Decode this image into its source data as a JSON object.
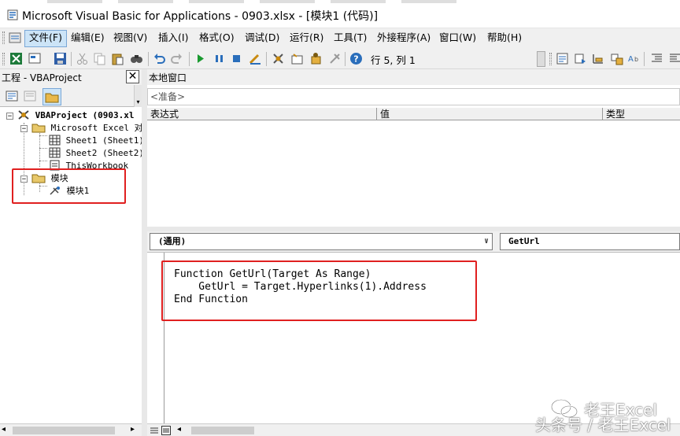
{
  "window": {
    "title": "Microsoft Visual Basic for Applications - 0903.xlsx - [模块1 (代码)]"
  },
  "menu": {
    "items": [
      {
        "label": "文件(F)",
        "active": true
      },
      {
        "label": "编辑(E)"
      },
      {
        "label": "视图(V)"
      },
      {
        "label": "插入(I)"
      },
      {
        "label": "格式(O)"
      },
      {
        "label": "调试(D)"
      },
      {
        "label": "运行(R)"
      },
      {
        "label": "工具(T)"
      },
      {
        "label": "外接程序(A)"
      },
      {
        "label": "窗口(W)"
      },
      {
        "label": "帮助(H)"
      }
    ]
  },
  "toolbar": {
    "cursor_position": "行 5, 列 1",
    "icons": [
      "excel-view-icon",
      "insert-userform-icon",
      "save-icon",
      "cut-icon",
      "copy-icon",
      "paste-icon",
      "find-icon",
      "undo-icon",
      "redo-icon",
      "run-icon",
      "break-icon",
      "reset-icon",
      "design-mode-icon",
      "project-explorer-icon",
      "properties-icon",
      "object-browser-icon",
      "toolbox-icon",
      "help-icon"
    ]
  },
  "project_panel": {
    "title": "工程 - VBAProject",
    "tree": {
      "project": "VBAProject (0903.xl",
      "excel_objects_folder": "Microsoft Excel 对象",
      "sheets": [
        "Sheet1 (Sheet1)",
        "Sheet2 (Sheet2)",
        "ThisWorkbook"
      ],
      "modules_folder": "模块",
      "modules": [
        "模块1"
      ]
    }
  },
  "locals": {
    "title": "本地窗口",
    "context": "<准备>",
    "columns": [
      "表达式",
      "值",
      "类型"
    ]
  },
  "code_window": {
    "object_combo": "(通用)",
    "procedure_combo": "GetUrl",
    "lines": [
      "Function GetUrl(Target As Range)",
      "    GetUrl = Target.Hyperlinks(1).Address",
      "End Function"
    ]
  },
  "watermark": {
    "name": "老王Excel",
    "sub": "头条号 / 老王Excel"
  },
  "colors": {
    "highlight_box": "#e02020",
    "menu_active": "#cce4f7"
  }
}
